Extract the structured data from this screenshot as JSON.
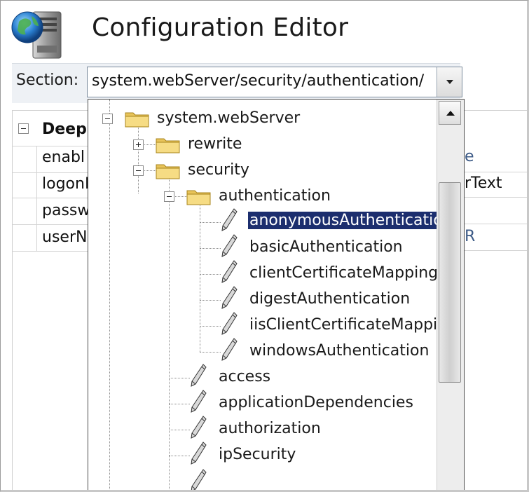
{
  "window": {
    "title": "Configuration Editor",
    "icon": "iis-globe-server-icon"
  },
  "section": {
    "label": "Section:",
    "value": "system.webServer/security/authentication/"
  },
  "grid": {
    "group_label": "Deep",
    "rows": [
      "enabl",
      "logonI",
      "passw",
      "userN"
    ],
    "right_values": [
      "e",
      "rText",
      "",
      "R"
    ]
  },
  "tree": {
    "nodes": [
      {
        "label": "system.webServer",
        "type": "folder",
        "expander": "minus"
      },
      {
        "label": "rewrite",
        "type": "folder",
        "expander": "plus"
      },
      {
        "label": "security",
        "type": "folder",
        "expander": "minus"
      },
      {
        "label": "authentication",
        "type": "folder",
        "expander": "minus"
      },
      {
        "label": "anonymousAuthenticatio",
        "type": "leaf",
        "selected": true
      },
      {
        "label": "basicAuthentication",
        "type": "leaf"
      },
      {
        "label": "clientCertificateMapping",
        "type": "leaf"
      },
      {
        "label": "digestAuthentication",
        "type": "leaf"
      },
      {
        "label": "iisClientCertificateMappir",
        "type": "leaf"
      },
      {
        "label": "windowsAuthentication",
        "type": "leaf"
      },
      {
        "label": "access",
        "type": "leaf"
      },
      {
        "label": "applicationDependencies",
        "type": "leaf"
      },
      {
        "label": "authorization",
        "type": "leaf"
      },
      {
        "label": "ipSecurity",
        "type": "leaf"
      }
    ]
  },
  "colors": {
    "selection": "#1c2e6e",
    "folder": "#e8c45a",
    "panel_bg": "#eef1f5"
  }
}
